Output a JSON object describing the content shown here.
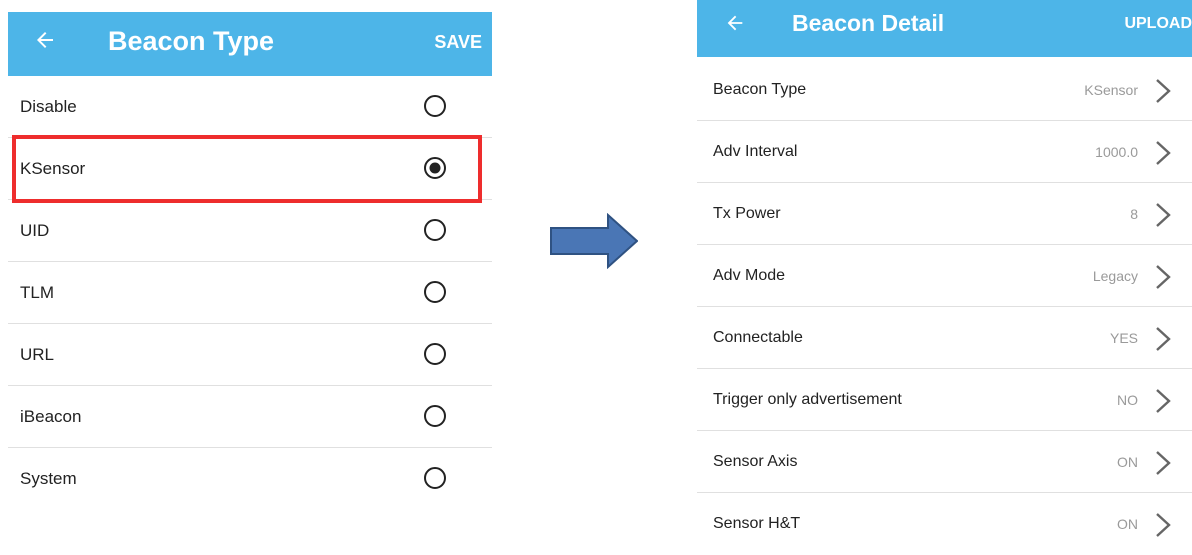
{
  "left_screen": {
    "title": "Beacon Type",
    "action": "SAVE",
    "options": [
      {
        "label": "Disable",
        "selected": false
      },
      {
        "label": "KSensor",
        "selected": true
      },
      {
        "label": "UID",
        "selected": false
      },
      {
        "label": "TLM",
        "selected": false
      },
      {
        "label": "URL",
        "selected": false
      },
      {
        "label": "iBeacon",
        "selected": false
      },
      {
        "label": "System",
        "selected": false
      }
    ],
    "highlighted_option": "KSensor"
  },
  "right_screen": {
    "title": "Beacon Detail",
    "action": "UPLOAD",
    "rows": [
      {
        "label": "Beacon Type",
        "value": "KSensor"
      },
      {
        "label": "Adv Interval",
        "value": "1000.0"
      },
      {
        "label": "Tx Power",
        "value": "8"
      },
      {
        "label": "Adv Mode",
        "value": "Legacy"
      },
      {
        "label": "Connectable",
        "value": "YES"
      },
      {
        "label": "Trigger only advertisement",
        "value": "NO"
      },
      {
        "label": "Sensor Axis",
        "value": "ON"
      },
      {
        "label": "Sensor H&T",
        "value": "ON"
      }
    ]
  },
  "icons": {
    "back": "back-arrow-icon",
    "radio_selected": "radio-selected-icon",
    "radio_unselected": "radio-unselected-icon",
    "chevron": "chevron-right-icon",
    "flow_arrow": "flow-arrow-icon"
  },
  "colors": {
    "appbar": "#4db5e8",
    "highlight": "#ee2d2d",
    "arrow_fill": "#4a76b5",
    "arrow_stroke": "#2f5282",
    "value_text": "#9a9a9a"
  }
}
